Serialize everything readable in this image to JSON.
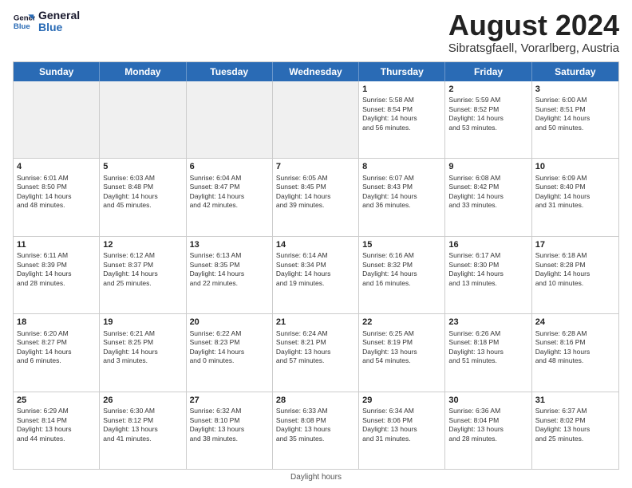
{
  "logo": {
    "line1": "General",
    "line2": "Blue"
  },
  "title": "August 2024",
  "subtitle": "Sibratsgfaell, Vorarlberg, Austria",
  "header_days": [
    "Sunday",
    "Monday",
    "Tuesday",
    "Wednesday",
    "Thursday",
    "Friday",
    "Saturday"
  ],
  "footer": "Daylight hours",
  "weeks": [
    [
      {
        "day": "",
        "text": "",
        "shaded": true
      },
      {
        "day": "",
        "text": "",
        "shaded": true
      },
      {
        "day": "",
        "text": "",
        "shaded": true
      },
      {
        "day": "",
        "text": "",
        "shaded": true
      },
      {
        "day": "1",
        "text": "Sunrise: 5:58 AM\nSunset: 8:54 PM\nDaylight: 14 hours\nand 56 minutes.",
        "shaded": false
      },
      {
        "day": "2",
        "text": "Sunrise: 5:59 AM\nSunset: 8:52 PM\nDaylight: 14 hours\nand 53 minutes.",
        "shaded": false
      },
      {
        "day": "3",
        "text": "Sunrise: 6:00 AM\nSunset: 8:51 PM\nDaylight: 14 hours\nand 50 minutes.",
        "shaded": false
      }
    ],
    [
      {
        "day": "4",
        "text": "Sunrise: 6:01 AM\nSunset: 8:50 PM\nDaylight: 14 hours\nand 48 minutes.",
        "shaded": false
      },
      {
        "day": "5",
        "text": "Sunrise: 6:03 AM\nSunset: 8:48 PM\nDaylight: 14 hours\nand 45 minutes.",
        "shaded": false
      },
      {
        "day": "6",
        "text": "Sunrise: 6:04 AM\nSunset: 8:47 PM\nDaylight: 14 hours\nand 42 minutes.",
        "shaded": false
      },
      {
        "day": "7",
        "text": "Sunrise: 6:05 AM\nSunset: 8:45 PM\nDaylight: 14 hours\nand 39 minutes.",
        "shaded": false
      },
      {
        "day": "8",
        "text": "Sunrise: 6:07 AM\nSunset: 8:43 PM\nDaylight: 14 hours\nand 36 minutes.",
        "shaded": false
      },
      {
        "day": "9",
        "text": "Sunrise: 6:08 AM\nSunset: 8:42 PM\nDaylight: 14 hours\nand 33 minutes.",
        "shaded": false
      },
      {
        "day": "10",
        "text": "Sunrise: 6:09 AM\nSunset: 8:40 PM\nDaylight: 14 hours\nand 31 minutes.",
        "shaded": false
      }
    ],
    [
      {
        "day": "11",
        "text": "Sunrise: 6:11 AM\nSunset: 8:39 PM\nDaylight: 14 hours\nand 28 minutes.",
        "shaded": false
      },
      {
        "day": "12",
        "text": "Sunrise: 6:12 AM\nSunset: 8:37 PM\nDaylight: 14 hours\nand 25 minutes.",
        "shaded": false
      },
      {
        "day": "13",
        "text": "Sunrise: 6:13 AM\nSunset: 8:35 PM\nDaylight: 14 hours\nand 22 minutes.",
        "shaded": false
      },
      {
        "day": "14",
        "text": "Sunrise: 6:14 AM\nSunset: 8:34 PM\nDaylight: 14 hours\nand 19 minutes.",
        "shaded": false
      },
      {
        "day": "15",
        "text": "Sunrise: 6:16 AM\nSunset: 8:32 PM\nDaylight: 14 hours\nand 16 minutes.",
        "shaded": false
      },
      {
        "day": "16",
        "text": "Sunrise: 6:17 AM\nSunset: 8:30 PM\nDaylight: 14 hours\nand 13 minutes.",
        "shaded": false
      },
      {
        "day": "17",
        "text": "Sunrise: 6:18 AM\nSunset: 8:28 PM\nDaylight: 14 hours\nand 10 minutes.",
        "shaded": false
      }
    ],
    [
      {
        "day": "18",
        "text": "Sunrise: 6:20 AM\nSunset: 8:27 PM\nDaylight: 14 hours\nand 6 minutes.",
        "shaded": false
      },
      {
        "day": "19",
        "text": "Sunrise: 6:21 AM\nSunset: 8:25 PM\nDaylight: 14 hours\nand 3 minutes.",
        "shaded": false
      },
      {
        "day": "20",
        "text": "Sunrise: 6:22 AM\nSunset: 8:23 PM\nDaylight: 14 hours\nand 0 minutes.",
        "shaded": false
      },
      {
        "day": "21",
        "text": "Sunrise: 6:24 AM\nSunset: 8:21 PM\nDaylight: 13 hours\nand 57 minutes.",
        "shaded": false
      },
      {
        "day": "22",
        "text": "Sunrise: 6:25 AM\nSunset: 8:19 PM\nDaylight: 13 hours\nand 54 minutes.",
        "shaded": false
      },
      {
        "day": "23",
        "text": "Sunrise: 6:26 AM\nSunset: 8:18 PM\nDaylight: 13 hours\nand 51 minutes.",
        "shaded": false
      },
      {
        "day": "24",
        "text": "Sunrise: 6:28 AM\nSunset: 8:16 PM\nDaylight: 13 hours\nand 48 minutes.",
        "shaded": false
      }
    ],
    [
      {
        "day": "25",
        "text": "Sunrise: 6:29 AM\nSunset: 8:14 PM\nDaylight: 13 hours\nand 44 minutes.",
        "shaded": false
      },
      {
        "day": "26",
        "text": "Sunrise: 6:30 AM\nSunset: 8:12 PM\nDaylight: 13 hours\nand 41 minutes.",
        "shaded": false
      },
      {
        "day": "27",
        "text": "Sunrise: 6:32 AM\nSunset: 8:10 PM\nDaylight: 13 hours\nand 38 minutes.",
        "shaded": false
      },
      {
        "day": "28",
        "text": "Sunrise: 6:33 AM\nSunset: 8:08 PM\nDaylight: 13 hours\nand 35 minutes.",
        "shaded": false
      },
      {
        "day": "29",
        "text": "Sunrise: 6:34 AM\nSunset: 8:06 PM\nDaylight: 13 hours\nand 31 minutes.",
        "shaded": false
      },
      {
        "day": "30",
        "text": "Sunrise: 6:36 AM\nSunset: 8:04 PM\nDaylight: 13 hours\nand 28 minutes.",
        "shaded": false
      },
      {
        "day": "31",
        "text": "Sunrise: 6:37 AM\nSunset: 8:02 PM\nDaylight: 13 hours\nand 25 minutes.",
        "shaded": false
      }
    ]
  ]
}
